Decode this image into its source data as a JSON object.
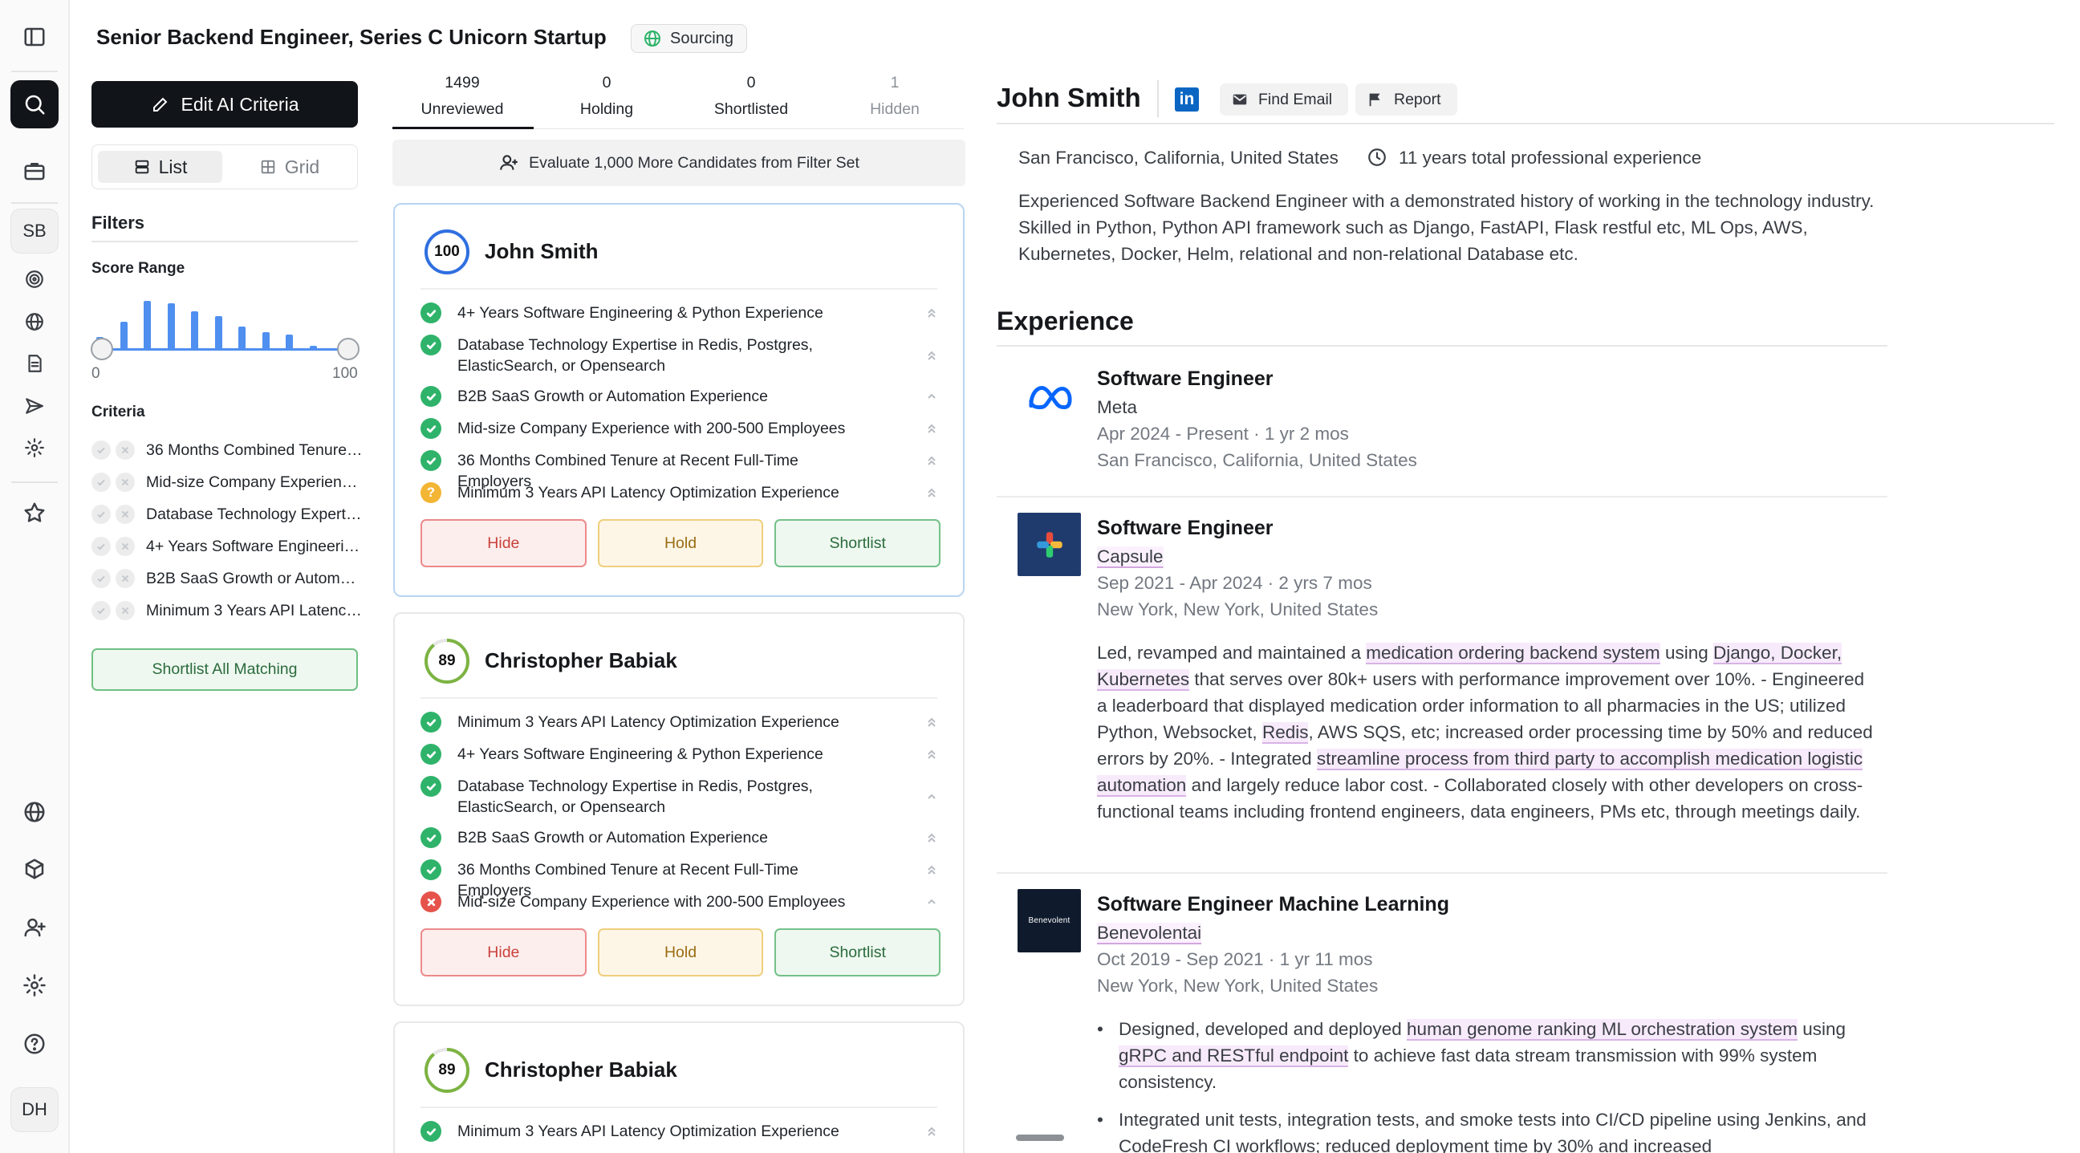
{
  "header": {
    "job_title": "Senior Backend Engineer, Series C Unicorn Startup",
    "status_badge": "Sourcing"
  },
  "rail": {
    "user_initials_top": "SB",
    "user_initials_bottom": "DH",
    "icons": [
      "sidebar-toggle-icon",
      "search-icon",
      "briefcase-icon",
      "target-icon",
      "globe-icon",
      "document-icon",
      "send-icon",
      "gear-icon",
      "star-icon",
      "globe-icon",
      "cube-icon",
      "add-user-icon",
      "gear-icon",
      "help-icon"
    ]
  },
  "filters": {
    "edit_ai_label": "Edit AI Criteria",
    "view_list": "List",
    "view_grid": "Grid",
    "title": "Filters",
    "score_range_label": "Score Range",
    "range_min": "0",
    "range_max": "100",
    "histogram": [
      0.25,
      0.55,
      0.95,
      0.9,
      0.75,
      0.65,
      0.45,
      0.35,
      0.3,
      0.08
    ],
    "criteria_label": "Criteria",
    "criteria": [
      "36 Months Combined Tenure at Recent Full-Time Employers",
      "Mid-size Company Experience with 200-500 Employees",
      "Database Technology Expertise in Redis, Postgres, ElasticSearch, or Opensearch",
      "4+ Years Software Engineering & Python Experience",
      "B2B SaaS Growth or Automation Experience",
      "Minimum 3 Years API Latency Optimization Experience"
    ],
    "shortlist_all": "Shortlist All Matching"
  },
  "tabs": [
    {
      "count": "1499",
      "label": "Unreviewed"
    },
    {
      "count": "0",
      "label": "Holding"
    },
    {
      "count": "0",
      "label": "Shortlisted"
    },
    {
      "count": "1",
      "label": "Hidden"
    }
  ],
  "evaluate_label": "Evaluate 1,000 More Candidates from Filter Set",
  "card_buttons": {
    "hide": "Hide",
    "hold": "Hold",
    "shortlist": "Shortlist"
  },
  "candidates": [
    {
      "name": "John Smith",
      "score": "100",
      "score_fraction": 1.0,
      "ring_color": "#2f6fe0",
      "criteria": [
        {
          "text": "4+ Years Software Engineering & Python Experience",
          "status": "ok"
        },
        {
          "text": "Database Technology Expertise in Redis, Postgres, ElasticSearch, or Opensearch",
          "status": "ok"
        },
        {
          "text": "B2B SaaS Growth or Automation Experience",
          "status": "ok"
        },
        {
          "text": "Mid-size Company Experience with 200-500 Employees",
          "status": "ok"
        },
        {
          "text": "36 Months Combined Tenure at Recent Full-Time Employers",
          "status": "ok"
        },
        {
          "text": "Minimum 3 Years API Latency Optimization Experience",
          "status": "warn"
        }
      ]
    },
    {
      "name": "Christopher Babiak",
      "score": "89",
      "score_fraction": 0.89,
      "ring_color": "#7cb342",
      "criteria": [
        {
          "text": "Minimum 3 Years API Latency Optimization Experience",
          "status": "ok"
        },
        {
          "text": "4+ Years Software Engineering & Python Experience",
          "status": "ok"
        },
        {
          "text": "Database Technology Expertise in Redis, Postgres, ElasticSearch, or Opensearch",
          "status": "ok"
        },
        {
          "text": "B2B SaaS Growth or Automation Experience",
          "status": "ok"
        },
        {
          "text": "36 Months Combined Tenure at Recent Full-Time Employers",
          "status": "ok"
        },
        {
          "text": "Mid-size Company Experience with 200-500 Employees",
          "status": "bad"
        }
      ]
    },
    {
      "name": "Christopher Babiak",
      "score": "89",
      "score_fraction": 0.89,
      "ring_color": "#7cb342",
      "criteria": [
        {
          "text": "Minimum 3 Years API Latency Optimization Experience",
          "status": "ok"
        }
      ]
    }
  ],
  "profile": {
    "name": "John Smith",
    "linkedin_glyph": "in",
    "find_email": "Find Email",
    "report": "Report",
    "location": "San Francisco, California, United States",
    "experience_total": "11 years total professional experience",
    "summary": "Experienced Software Backend Engineer with a demonstrated history of working in the technology industry. Skilled in Python, Python API framework such as Django, FastAPI, Flask restful etc, ML Ops, AWS, Kubernetes, Docker, Helm, relational and non-relational Database etc.",
    "experience_heading": "Experience",
    "jobs": [
      {
        "title": "Software Engineer",
        "company": "Meta",
        "dates": "Apr 2024 - Present",
        "duration": "1 yr 2 mos",
        "location": "San Francisco, California, United States"
      },
      {
        "title": "Software Engineer",
        "company": "Capsule",
        "dates": "Sep 2021 - Apr 2024",
        "duration": "2 yrs 7 mos",
        "location": "New York, New York, United States",
        "description": [
          {
            "t": "Led, revamped and maintained a "
          },
          {
            "t": "medication ordering backend system",
            "h": true
          },
          {
            "t": " using "
          },
          {
            "t": "Django, Docker, Kubernetes",
            "h": true
          },
          {
            "t": " that serves over 80k+ users with performance improvement over 10%. - Engineered a leaderboard that displayed medication order information to all pharmacies in the US; utilized Python, Websocket, "
          },
          {
            "t": "Redis",
            "h": true
          },
          {
            "t": ", AWS SQS, etc; increased order processing time by 50% and reduced errors by 20%. - Integrated "
          },
          {
            "t": "streamline process from third party to accomplish medication logistic automation",
            "h": true
          },
          {
            "t": " and largely reduce labor cost. - Collaborated closely with other developers on cross-functional teams including frontend engineers, data engineers, PMs etc, through meetings daily."
          }
        ]
      },
      {
        "title": "Software Engineer Machine Learning",
        "company": "Benevolentai",
        "logo_text": "Benevolent",
        "dates": "Oct 2019 - Sep 2021",
        "duration": "1 yr 11 mos",
        "location": "New York, New York, United States",
        "bullets": [
          [
            {
              "t": "Designed, developed and deployed "
            },
            {
              "t": "human genome ranking ML orchestration system",
              "h": true
            },
            {
              "t": " using "
            },
            {
              "t": "gRPC and RESTful endpoint",
              "h": true
            },
            {
              "t": " to achieve fast data stream transmission with 99% system consistency."
            }
          ],
          [
            {
              "t": "Integrated unit tests, integration tests, and smoke tests into CI/CD pipeline using Jenkins, and CodeFresh CI workflows; reduced deployment time by 30% and increased"
            }
          ]
        ]
      }
    ]
  }
}
